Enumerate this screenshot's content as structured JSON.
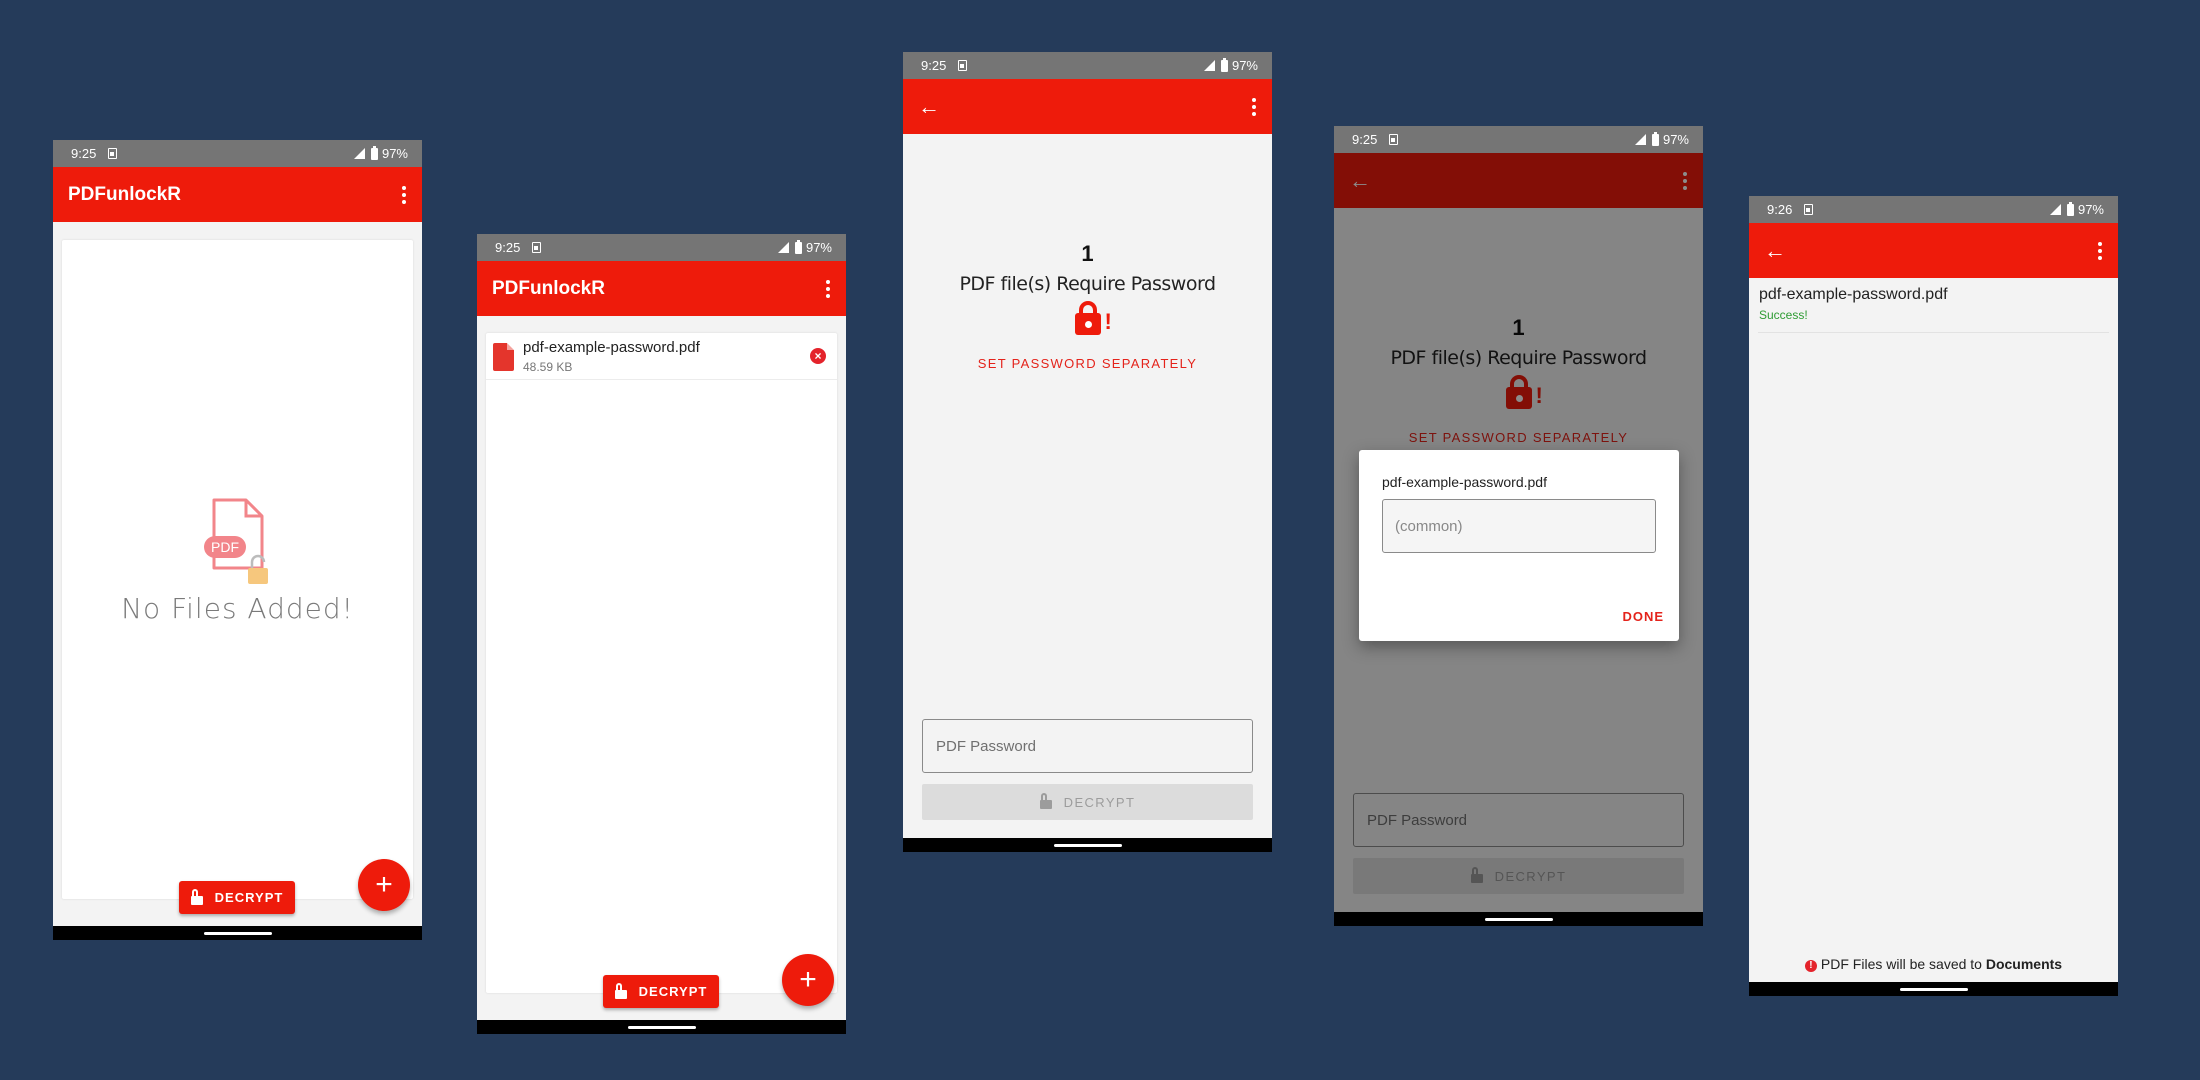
{
  "status_bar": {
    "battery": "97%"
  },
  "phones": [
    {
      "time": "9:25",
      "title": "PDFunlockR",
      "empty_message": "No Files Added!",
      "empty_icon_label": "PDF",
      "decrypt_label": "DECRYPT",
      "fab_label": "+"
    },
    {
      "time": "9:25",
      "title": "PDFunlockR",
      "files": [
        {
          "name": "pdf-example-password.pdf",
          "size": "48.59 KB"
        }
      ],
      "decrypt_label": "DECRYPT",
      "fab_label": "+"
    },
    {
      "time": "9:25",
      "back": "←",
      "count": "1",
      "require_label": "PDF file(s) Require Password",
      "set_separately_label": "SET PASSWORD SEPARATELY",
      "password_placeholder": "PDF Password",
      "decrypt_label": "DECRYPT"
    },
    {
      "time": "9:25",
      "back": "←",
      "count": "1",
      "require_label": "PDF file(s) Require Password",
      "set_separately_label": "SET PASSWORD SEPARATELY",
      "password_placeholder": "PDF Password",
      "decrypt_label": "DECRYPT",
      "dialog": {
        "file_name": "pdf-example-password.pdf",
        "input_placeholder": "(common)",
        "done_label": "DONE"
      }
    },
    {
      "time": "9:26",
      "back": "←",
      "results": [
        {
          "name": "pdf-example-password.pdf",
          "status": "Success!"
        }
      ],
      "footer_prefix": "PDF Files will be saved to ",
      "footer_location": "Documents"
    }
  ],
  "colors": {
    "background": "#253b5a",
    "accent": "#ee1b0b",
    "success": "#2e9c33"
  }
}
